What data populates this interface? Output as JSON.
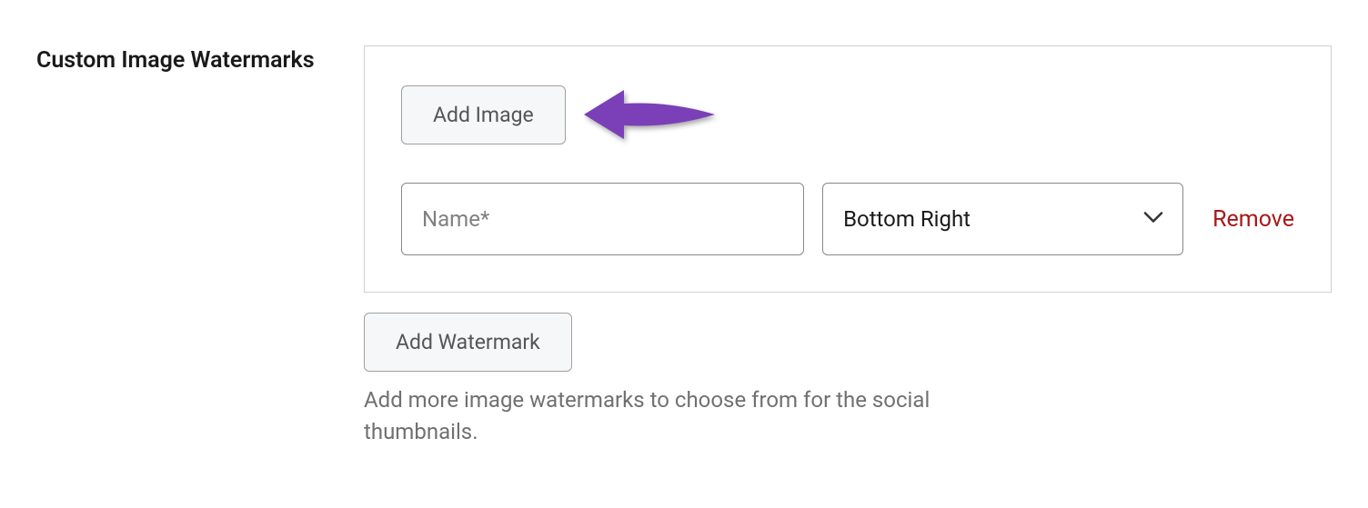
{
  "section": {
    "label": "Custom Image Watermarks"
  },
  "watermark": {
    "add_image_label": "Add Image",
    "name_placeholder": "Name*",
    "name_value": "",
    "position_selected": "Bottom Right",
    "remove_label": "Remove"
  },
  "actions": {
    "add_watermark_label": "Add Watermark"
  },
  "help_text": "Add more image watermarks to choose from for the social thumbnails.",
  "colors": {
    "arrow": "#7b3fb8",
    "remove": "#a81818"
  }
}
